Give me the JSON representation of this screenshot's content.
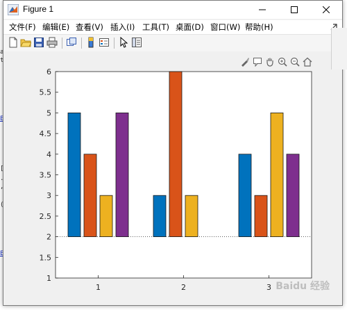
{
  "window": {
    "title": "Figure 1"
  },
  "menu": [
    {
      "label": "文件(F)"
    },
    {
      "label": "编辑(E)"
    },
    {
      "label": "查看(V)"
    },
    {
      "label": "插入(I)"
    },
    {
      "label": "工具(T)"
    },
    {
      "label": "桌面(D)"
    },
    {
      "label": "窗口(W)"
    },
    {
      "label": "帮助(H)"
    }
  ],
  "toolbar_icons": [
    "new-figure-icon",
    "open-file-icon",
    "save-icon",
    "print-icon",
    "link-icon",
    "colorbar-icon",
    "legend-icon",
    "pointer-icon",
    "property-inspector-icon"
  ],
  "axes_toolbar_icons": [
    "brush-icon",
    "data-tips-icon",
    "pan-icon",
    "zoom-in-icon",
    "zoom-out-icon",
    "home-icon"
  ],
  "colors": {
    "series1": "#0072bd",
    "series2": "#d95319",
    "series3": "#edb120",
    "series4": "#7e2f8e",
    "baseline": "#262626"
  },
  "background": {
    "fragments": [
      "a",
      "ts",
      "",
      "",
      ",",
      "(",
      "[",
      ".",
      ".",
      ".",
      ";",
      "a",
      "s"
    ],
    "links": [
      "B",
      "B"
    ]
  },
  "watermark": "Baidu 经验",
  "chart_data": {
    "type": "bar",
    "categories": [
      "1",
      "2",
      "3"
    ],
    "series": [
      {
        "values": [
          5,
          3,
          4
        ]
      },
      {
        "values": [
          4,
          6,
          3
        ]
      },
      {
        "values": [
          3,
          3,
          5
        ]
      },
      {
        "values": [
          5,
          2,
          4
        ]
      }
    ],
    "base_value": 2,
    "ylim": [
      1,
      6
    ],
    "yticks": [
      "1",
      "1.5",
      "2",
      "2.5",
      "3",
      "3.5",
      "4",
      "4.5",
      "5",
      "5.5",
      "6"
    ],
    "xticks": [
      "1",
      "2",
      "3"
    ],
    "grid": false,
    "legend": "none",
    "title": "",
    "xlabel": "",
    "ylabel": ""
  }
}
